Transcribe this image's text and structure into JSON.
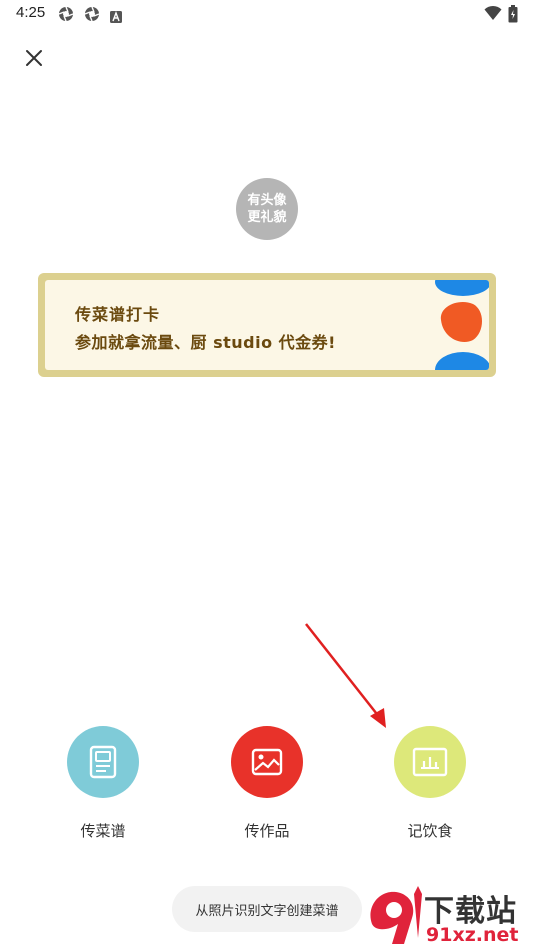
{
  "status_bar": {
    "time": "4:25",
    "left_icons": [
      "aperture-icon",
      "aperture-icon",
      "font-a-icon"
    ],
    "right_icons": [
      "wifi-icon",
      "battery-icon"
    ]
  },
  "header": {
    "close_icon": "close-icon"
  },
  "avatar": {
    "text": "有头像更礼貌"
  },
  "banner": {
    "title": "传菜谱打卡",
    "subtitle": "参加就拿流量、厨 studio 代金券!",
    "colors": {
      "border": "#dcd08f",
      "background": "#fcf7e6",
      "text": "#6b4a0f",
      "blue": "#1e88e5",
      "orange": "#f05a24"
    }
  },
  "actions": [
    {
      "label": "传菜谱",
      "icon": "recipe-document-icon",
      "color": "#7fcbd8"
    },
    {
      "label": "传作品",
      "icon": "image-icon",
      "color": "#e8322a"
    },
    {
      "label": "记饮食",
      "icon": "chart-frame-icon",
      "color": "#dde87a"
    }
  ],
  "ocr_button": {
    "label": "从照片识别文字创建菜谱"
  },
  "watermark": {
    "title": "下载站",
    "url": "91xz.net"
  }
}
